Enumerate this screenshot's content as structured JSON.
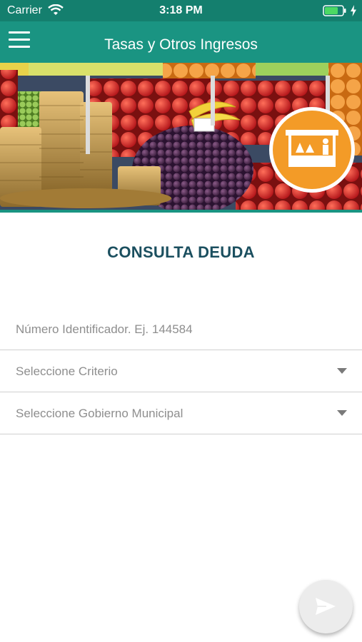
{
  "status_bar": {
    "carrier": "Carrier",
    "time": "3:18 PM"
  },
  "app_bar": {
    "title": "Tasas y Otros Ingresos"
  },
  "main": {
    "section_title": "CONSULTA DEUDA",
    "id_field": {
      "placeholder": "Número Identificador. Ej. 144584",
      "value": ""
    },
    "criterio_select": {
      "selected": "Seleccione Criterio"
    },
    "gobierno_select": {
      "selected": "Seleccione Gobierno Municipal"
    }
  },
  "colors": {
    "status_bar_bg": "#147f6e",
    "app_bar_bg": "#1a9482",
    "title_color": "#1b4f5f",
    "badge_orange": "#f39b27",
    "fab_bg": "#ececec"
  },
  "icons": {
    "menu": "hamburger-icon",
    "banner_badge": "market-stall-icon",
    "submit": "send-icon"
  }
}
